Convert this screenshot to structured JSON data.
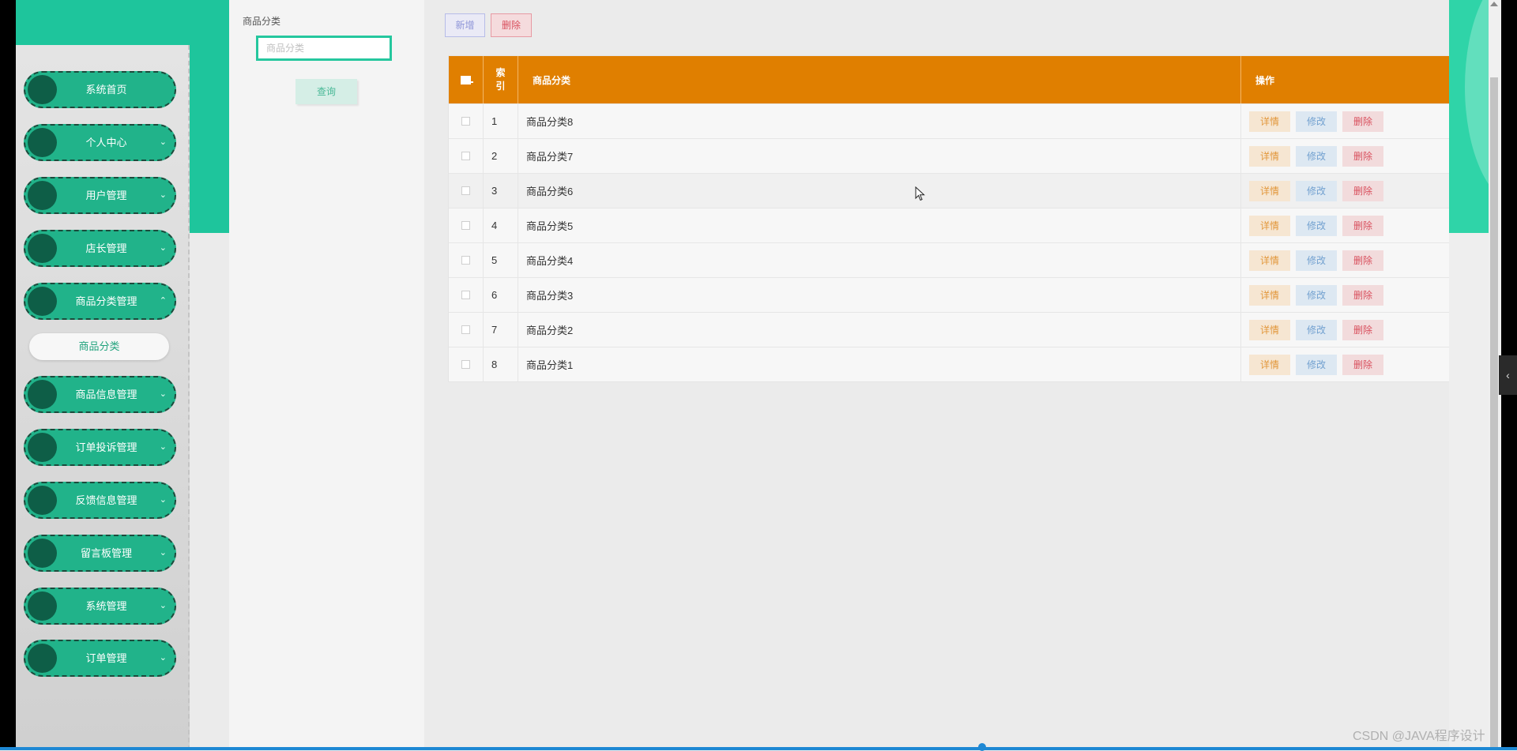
{
  "sidebar": {
    "items": [
      {
        "label": "系统首页",
        "expand": ""
      },
      {
        "label": "个人中心",
        "expand": "⌄"
      },
      {
        "label": "用户管理",
        "expand": "⌄"
      },
      {
        "label": "店长管理",
        "expand": "⌄"
      },
      {
        "label": "商品分类管理",
        "expand": "⌃"
      },
      {
        "label": "商品信息管理",
        "expand": "⌄"
      },
      {
        "label": "订单投诉管理",
        "expand": "⌄"
      },
      {
        "label": "反馈信息管理",
        "expand": "⌄"
      },
      {
        "label": "留言板管理",
        "expand": "⌄"
      },
      {
        "label": "系统管理",
        "expand": "⌄"
      },
      {
        "label": "订单管理",
        "expand": "⌄"
      }
    ],
    "active_sub_item": "商品分类"
  },
  "search": {
    "label": "商品分类",
    "placeholder": "商品分类",
    "value": "",
    "query_label": "查询"
  },
  "toolbar": {
    "add_label": "新增",
    "delete_label": "删除"
  },
  "table": {
    "headers": {
      "index": "索\n引",
      "name": "商品分类",
      "ops": "操作"
    },
    "rows": [
      {
        "index": "1",
        "name": "商品分类8"
      },
      {
        "index": "2",
        "name": "商品分类7"
      },
      {
        "index": "3",
        "name": "商品分类6"
      },
      {
        "index": "4",
        "name": "商品分类5"
      },
      {
        "index": "5",
        "name": "商品分类4"
      },
      {
        "index": "6",
        "name": "商品分类3"
      },
      {
        "index": "7",
        "name": "商品分类2"
      },
      {
        "index": "8",
        "name": "商品分类1"
      }
    ],
    "row_actions": {
      "detail": "详情",
      "edit": "修改",
      "delete": "删除"
    }
  },
  "collapse_icon": "‹",
  "watermark": "CSDN @JAVA程序设计",
  "colors": {
    "accent_teal": "#1ec59c",
    "menu_green": "#21b38a",
    "header_orange": "#e07f00",
    "danger": "#d9505e",
    "info_blue": "#72a1d0",
    "warning": "#e2973b"
  }
}
